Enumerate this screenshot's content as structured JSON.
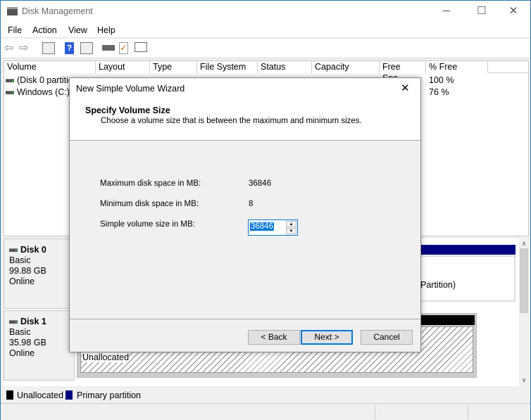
{
  "window": {
    "title": "Disk Management",
    "minimize": "─",
    "maximize": "☐",
    "close": "✕"
  },
  "menu": [
    "File",
    "Action",
    "View",
    "Help"
  ],
  "toolbar": [
    "back-icon",
    "forward-icon",
    "console-tree-icon",
    "help-icon",
    "properties-icon",
    "connect-icon",
    "check-icon",
    "list-icon"
  ],
  "volume_list": {
    "columns": [
      "Volume",
      "Layout",
      "Type",
      "File System",
      "Status",
      "Capacity",
      "Free Spa...",
      "% Free"
    ],
    "rows": [
      {
        "volume": "(Disk 0 partitio",
        "pct_free": "100 %"
      },
      {
        "volume": "Windows (C:)",
        "pct_free": "76 %"
      }
    ]
  },
  "disks": [
    {
      "name": "Disk 0",
      "type": "Basic",
      "size": "99.88 GB",
      "status": "Online",
      "partition_text": "Partition)"
    },
    {
      "name": "Disk 1",
      "type": "Basic",
      "size": "35.98 GB",
      "status": "Online",
      "partition_text": "Unallocated"
    }
  ],
  "legend": [
    {
      "label": "Unallocated",
      "color": "#000000"
    },
    {
      "label": "Primary partition",
      "color": "#000080"
    }
  ],
  "wizard": {
    "title": "New Simple Volume Wizard",
    "heading": "Specify Volume Size",
    "subheading": "Choose a volume size that is between the maximum and minimum sizes.",
    "max_label": "Maximum disk space in MB:",
    "max_value": "36846",
    "min_label": "Minimum disk space in MB:",
    "min_value": "8",
    "size_label": "Simple volume size in MB:",
    "size_value": "36846",
    "back": "< Back",
    "next": "Next >",
    "cancel": "Cancel",
    "close": "✕"
  },
  "colors": {
    "primary": "#000080",
    "unallocated": "#000000",
    "accent": "#0078d7"
  }
}
